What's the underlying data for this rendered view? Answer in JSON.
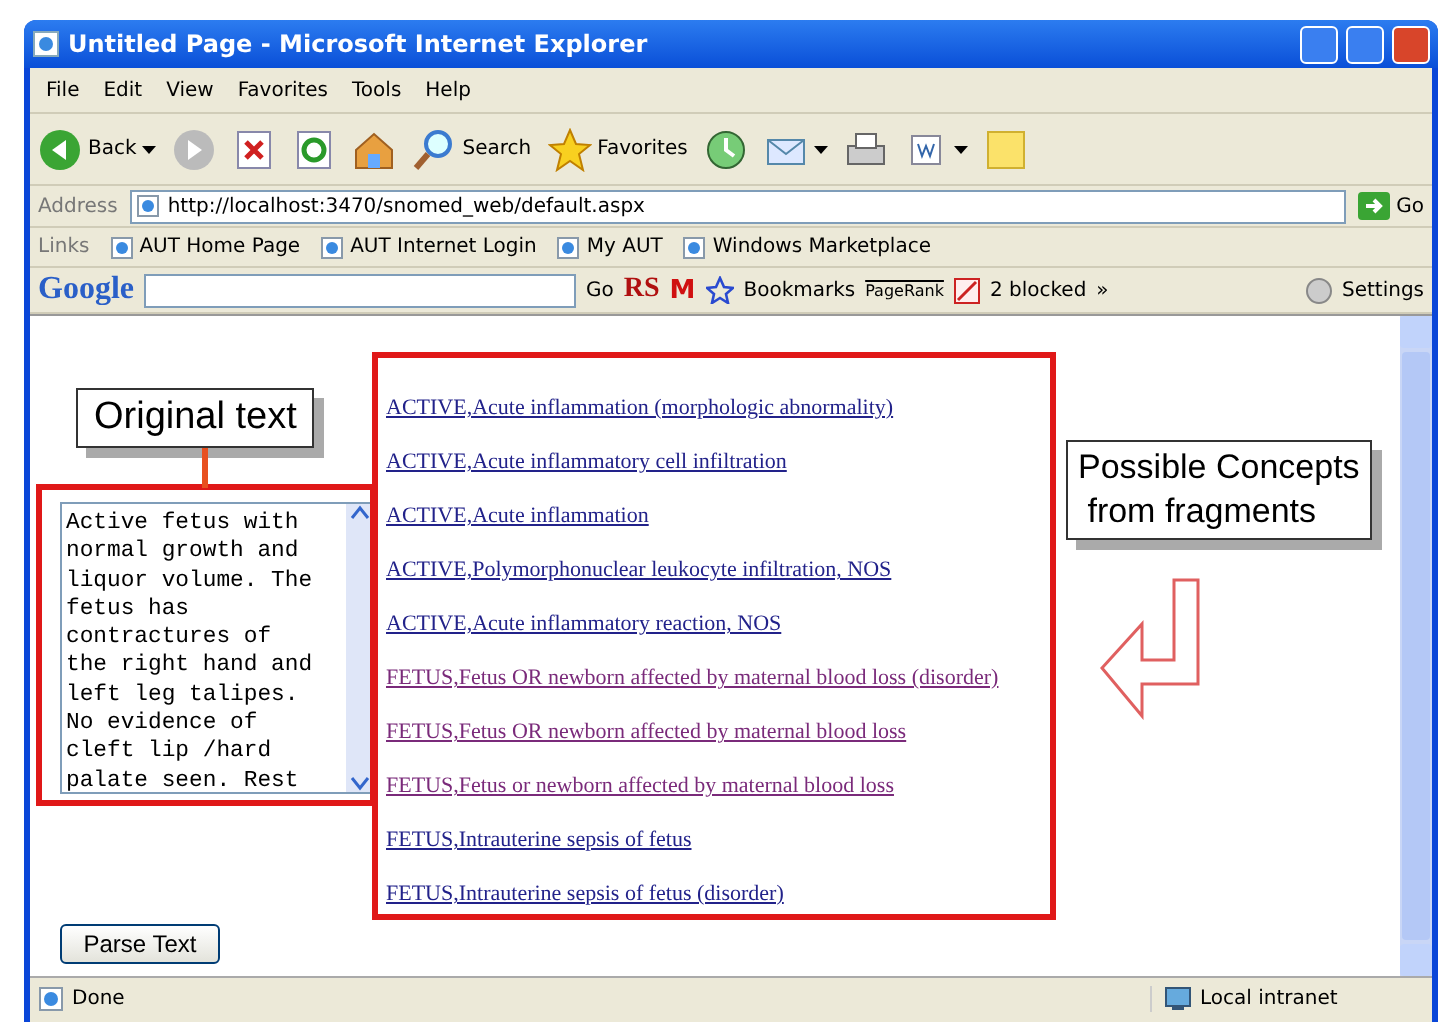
{
  "window": {
    "title": "Untitled Page - Microsoft Internet Explorer"
  },
  "menu": [
    "File",
    "Edit",
    "View",
    "Favorites",
    "Tools",
    "Help"
  ],
  "toolbar": [
    {
      "kind": "back",
      "label": "Back"
    },
    {
      "kind": "forward"
    },
    {
      "kind": "stop"
    },
    {
      "kind": "refresh"
    },
    {
      "kind": "home"
    },
    {
      "kind": "search",
      "label": "Search"
    },
    {
      "kind": "favorites",
      "label": "Favorites"
    },
    {
      "kind": "history"
    },
    {
      "kind": "mail"
    },
    {
      "kind": "print"
    },
    {
      "kind": "edit"
    },
    {
      "kind": "note"
    }
  ],
  "address": {
    "label": "Address",
    "url": "http://localhost:3470/snomed_web/default.aspx",
    "go": "Go"
  },
  "links": {
    "label": "Links",
    "items": [
      "AUT Home Page",
      "AUT Internet Login",
      "My AUT",
      "Windows Marketplace"
    ]
  },
  "google": {
    "logo": "Google",
    "go": "Go",
    "rs": "RS",
    "mail": "M",
    "bookmarks": "Bookmarks",
    "pagerank": "PageRank",
    "blocked": "2 blocked",
    "more": "»",
    "settings": "Settings"
  },
  "page": {
    "textarea": "Active fetus with normal growth and liquor volume. The fetus has contractures of the right hand and left leg talipes. No evidence of cleft lip /hard palate seen. Rest",
    "button": "Parse Text",
    "concepts": [
      {
        "text": "ACTIVE,Acute inflammation (morphologic abnormality)",
        "visited": false
      },
      {
        "text": "ACTIVE,Acute inflammatory cell infiltration",
        "visited": false
      },
      {
        "text": "ACTIVE,Acute inflammation",
        "visited": false
      },
      {
        "text": "ACTIVE,Polymorphonuclear leukocyte infiltration, NOS",
        "visited": false
      },
      {
        "text": "ACTIVE,Acute inflammatory reaction, NOS",
        "visited": false
      },
      {
        "text": "FETUS,Fetus OR newborn affected by maternal blood loss (disorder)",
        "visited": true
      },
      {
        "text": "FETUS,Fetus OR newborn affected by maternal blood loss",
        "visited": true
      },
      {
        "text": "FETUS,Fetus or newborn affected by maternal blood loss",
        "visited": true
      },
      {
        "text": "FETUS,Intrauterine sepsis of fetus",
        "visited": false
      },
      {
        "text": "FETUS,Intrauterine sepsis of fetus (disorder)",
        "visited": false
      }
    ]
  },
  "annotations": {
    "original": "Original text",
    "concepts": [
      "Possible Concepts",
      " from fragments"
    ]
  },
  "status_bar": {
    "text": "Done",
    "zone": "Local intranet"
  }
}
